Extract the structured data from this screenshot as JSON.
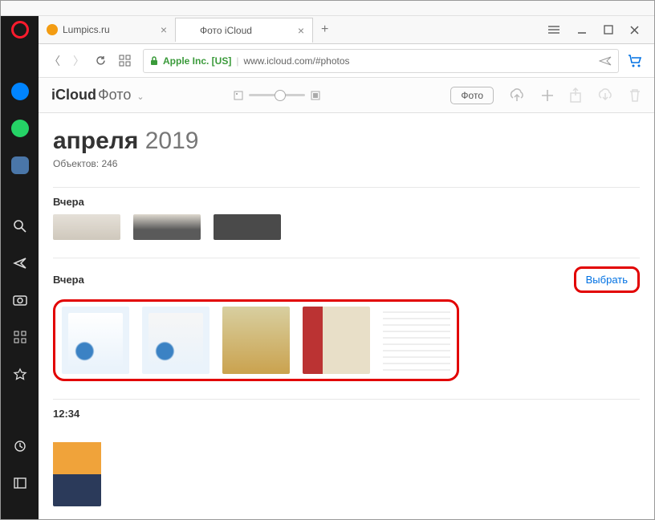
{
  "browser": {
    "tabs": [
      {
        "title": "Lumpics.ru",
        "active": false,
        "favicon_color": "#f39c12"
      },
      {
        "title": "Фото iCloud",
        "active": true,
        "favicon_color": "#555"
      }
    ],
    "security_label": "Apple Inc. [US]",
    "url": "www.icloud.com/#photos"
  },
  "icloud": {
    "brand": "iCloud",
    "section": "Фото",
    "view_button": "Фото"
  },
  "page": {
    "month": "апреля",
    "year": "2019",
    "count_label": "Объектов: 246",
    "groups": [
      {
        "header": "Вчера",
        "action": "",
        "thumb_count": 3,
        "highlighted": false
      },
      {
        "header": "Вчера",
        "action": "Выбрать",
        "thumb_count": 5,
        "highlighted": true
      },
      {
        "header": "12:34",
        "action": "",
        "thumb_count": 1,
        "highlighted": false
      }
    ]
  }
}
